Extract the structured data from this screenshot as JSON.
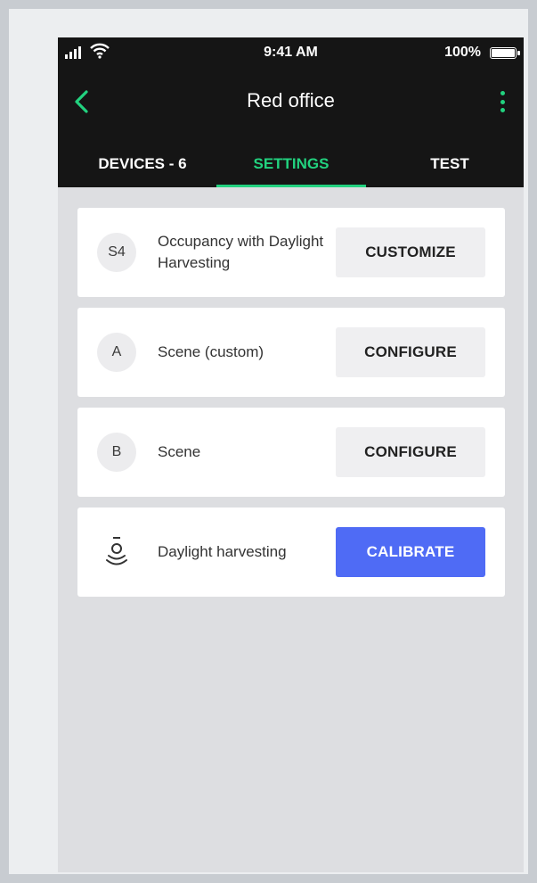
{
  "status_bar": {
    "time": "9:41 AM",
    "battery": "100%"
  },
  "header": {
    "title": "Red office"
  },
  "tabs": [
    {
      "label": "DEVICES - 6",
      "active": false
    },
    {
      "label": "SETTINGS",
      "active": true
    },
    {
      "label": "TEST",
      "active": false
    }
  ],
  "settings": [
    {
      "badge": "S4",
      "label": "Occupancy with Daylight Harvesting",
      "button": "CUSTOMIZE"
    },
    {
      "badge": "A",
      "label": "Scene (custom)",
      "button": "CONFIGURE"
    },
    {
      "badge": "B",
      "label": "Scene",
      "button": "CONFIGURE"
    },
    {
      "icon": "light-sensor-icon",
      "label": "Daylight harvesting",
      "button": "CALIBRATE",
      "button_style": "primary"
    }
  ],
  "colors": {
    "accent": "#22d27f",
    "primary_button": "#4f6bf5",
    "header_bg": "#151515"
  }
}
